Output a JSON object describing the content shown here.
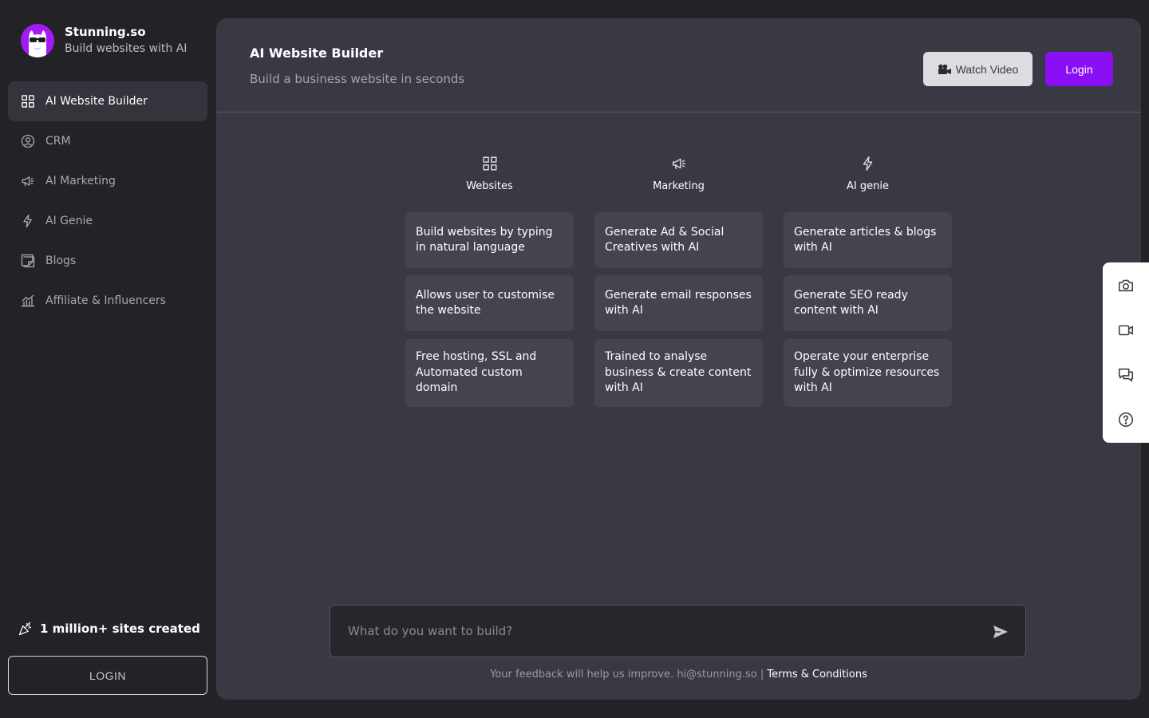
{
  "brand": {
    "name": "Stunning.so",
    "tagline": "Build websites with AI",
    "logo_color": "#a21bf5"
  },
  "sidebar": {
    "items": [
      {
        "label": "AI Website Builder",
        "icon": "grid-icon",
        "active": true
      },
      {
        "label": "CRM",
        "icon": "user-circle-icon",
        "active": false
      },
      {
        "label": "AI Marketing",
        "icon": "megaphone-icon",
        "active": false
      },
      {
        "label": "AI Genie",
        "icon": "bolt-icon",
        "active": false
      },
      {
        "label": "Blogs",
        "icon": "sticky-note-icon",
        "active": false
      },
      {
        "label": "Affiliate & Influencers",
        "icon": "bar-chart-icon",
        "active": false
      }
    ],
    "sites_created": "1 million+ sites created",
    "login_label": "LOGIN"
  },
  "header": {
    "title": "AI Website Builder",
    "subtitle": "Build a business website in seconds",
    "watch_video_label": "Watch Video",
    "login_label": "Login",
    "accent_color": "#8b0ff5"
  },
  "columns": [
    {
      "title": "Websites",
      "icon": "grid-icon",
      "cards": [
        "Build websites by typing in natural language",
        "Allows user to customise the website",
        "Free hosting, SSL and Automated custom domain"
      ]
    },
    {
      "title": "Marketing",
      "icon": "megaphone-icon",
      "cards": [
        "Generate Ad & Social Creatives with AI",
        "Generate email responses with AI",
        "Trained to analyse business & create content with AI"
      ]
    },
    {
      "title": "AI genie",
      "icon": "bolt-icon",
      "cards": [
        "Generate articles & blogs with AI",
        "Generate SEO ready content with AI",
        "Operate your enterprise fully & optimize resources with AI"
      ]
    }
  ],
  "prompt": {
    "placeholder": "What do you want to build?",
    "value": ""
  },
  "footer": {
    "feedback_text": "Your feedback will help us improve. hi@stunning.so |",
    "terms_label": "Terms & Conditions"
  },
  "side_tools": [
    "camera-icon",
    "video-icon",
    "chat-icon",
    "help-icon"
  ]
}
